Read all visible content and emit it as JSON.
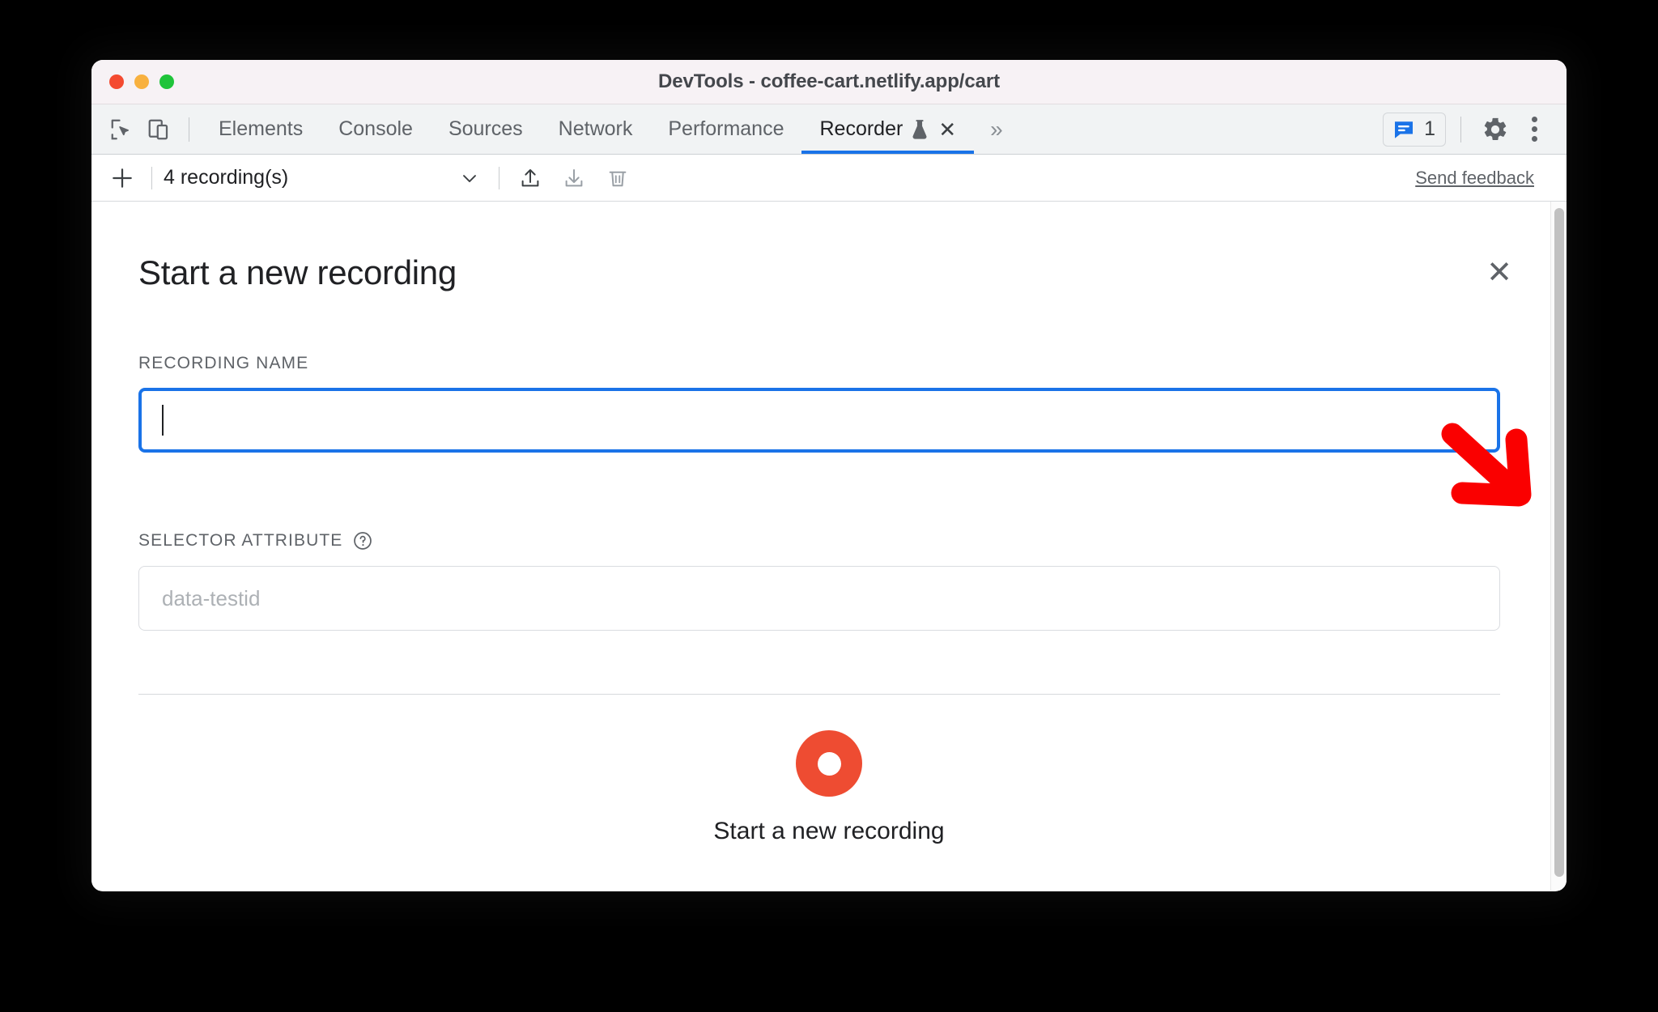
{
  "window": {
    "title": "DevTools - coffee-cart.netlify.app/cart",
    "traffic_lights": [
      "close",
      "minimize",
      "maximize"
    ],
    "colors": {
      "close": "#f44a30",
      "minimize": "#f8b13f",
      "maximize": "#1fc43a",
      "accent_blue": "#1a73e8",
      "record_red": "#ee4c32",
      "annotation_red": "#fa0000"
    }
  },
  "tabbar": {
    "inspect_icon": "inspect-element-icon",
    "device_icon": "device-toolbar-icon",
    "tabs": [
      {
        "label": "Elements",
        "active": false
      },
      {
        "label": "Console",
        "active": false
      },
      {
        "label": "Sources",
        "active": false
      },
      {
        "label": "Network",
        "active": false
      },
      {
        "label": "Performance",
        "active": false
      },
      {
        "label": "Recorder",
        "active": true,
        "experimental_icon": "flask-icon",
        "closable": true
      }
    ],
    "more_tabs": "»",
    "issues": {
      "icon": "issues-message-icon",
      "count": "1"
    },
    "settings_icon": "gear-icon",
    "menu_icon": "kebab-menu-icon"
  },
  "recorder_toolbar": {
    "add_icon": "plus-icon",
    "recordings_label": "4 recording(s)",
    "dropdown_icon": "chevron-down-icon",
    "export_icon": "export-upload-icon",
    "import_icon": "import-download-icon",
    "delete_icon": "trash-icon",
    "feedback_link": "Send feedback"
  },
  "form": {
    "title": "Start a new recording",
    "close_icon": "close-icon",
    "recording_name": {
      "label": "RECORDING NAME",
      "value": "",
      "placeholder": "",
      "focused": true
    },
    "selector_attribute": {
      "label": "SELECTOR ATTRIBUTE",
      "help_icon": "help-question-icon",
      "value": "",
      "placeholder": "data-testid",
      "focused": false
    },
    "record_button": {
      "icon": "record-circle-icon",
      "label": "Start a new recording"
    }
  },
  "annotation": {
    "arrow": "red-arrow-pointing-to-close-button"
  }
}
